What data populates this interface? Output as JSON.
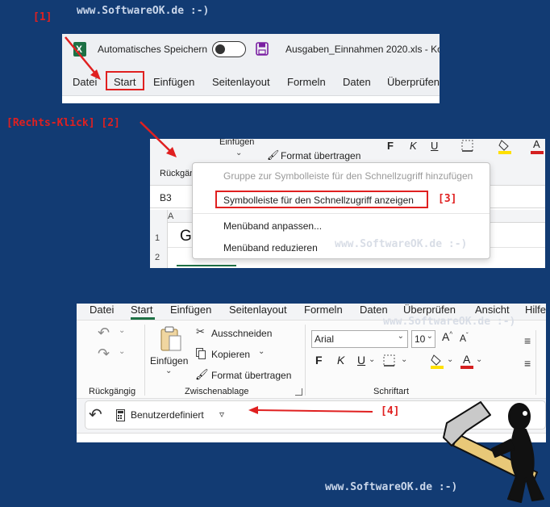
{
  "watermark": "www.SoftwareOK.de :-)",
  "steps": {
    "s1": "[1]",
    "s2": "[Rechts-Klick] [2]",
    "s3": "[3]",
    "s4": "[4]"
  },
  "panel1": {
    "autosave_label": "Automatisches Speichern",
    "filename": "Ausgaben_Einnahmen 2020.xls - Ko",
    "menu": [
      "Datei",
      "Start",
      "Einfügen",
      "Seitenlayout",
      "Formeln",
      "Daten",
      "Überprüfen"
    ]
  },
  "panel2": {
    "einfuegen": "Einfügen",
    "format_painter": "Format übertragen",
    "undo_group": "Rückgängi",
    "name_box": "B3",
    "col_a": "A",
    "row1": "1",
    "row2": "2",
    "cell_text": "G",
    "bold": "F",
    "italic": "K",
    "underline": "U",
    "context_menu": [
      {
        "label": "Gruppe zur Symbolleiste für den Schnellzugriff hinzufügen",
        "disabled": true
      },
      {
        "label": "Symbolleiste für den Schnellzugriff anzeigen",
        "disabled": false
      },
      {
        "label": "Menüband anpassen...",
        "disabled": false
      },
      {
        "label": "Menüband reduzieren",
        "disabled": false
      }
    ]
  },
  "panel3": {
    "tabs": [
      "Datei",
      "Start",
      "Einfügen",
      "Seitenlayout",
      "Formeln",
      "Daten",
      "Überprüfen",
      "Ansicht",
      "Hilfe"
    ],
    "undo_group": "Rückgängig",
    "clipboard_group": "Zwischenablage",
    "font_group": "Schriftart",
    "paste": "Einfügen",
    "cut": "Ausschneiden",
    "copy": "Kopieren",
    "format_painter": "Format übertragen",
    "font_name": "Arial",
    "font_size": "10",
    "bold": "F",
    "italic": "K",
    "underline": "U",
    "qat_format": "Benutzerdefiniert"
  },
  "colors": {
    "background": "#123b73",
    "highlight_red": "#e02020",
    "excel_green": "#1e7145",
    "highlight_yellow": "#ffe000",
    "font_red": "#d42020"
  }
}
